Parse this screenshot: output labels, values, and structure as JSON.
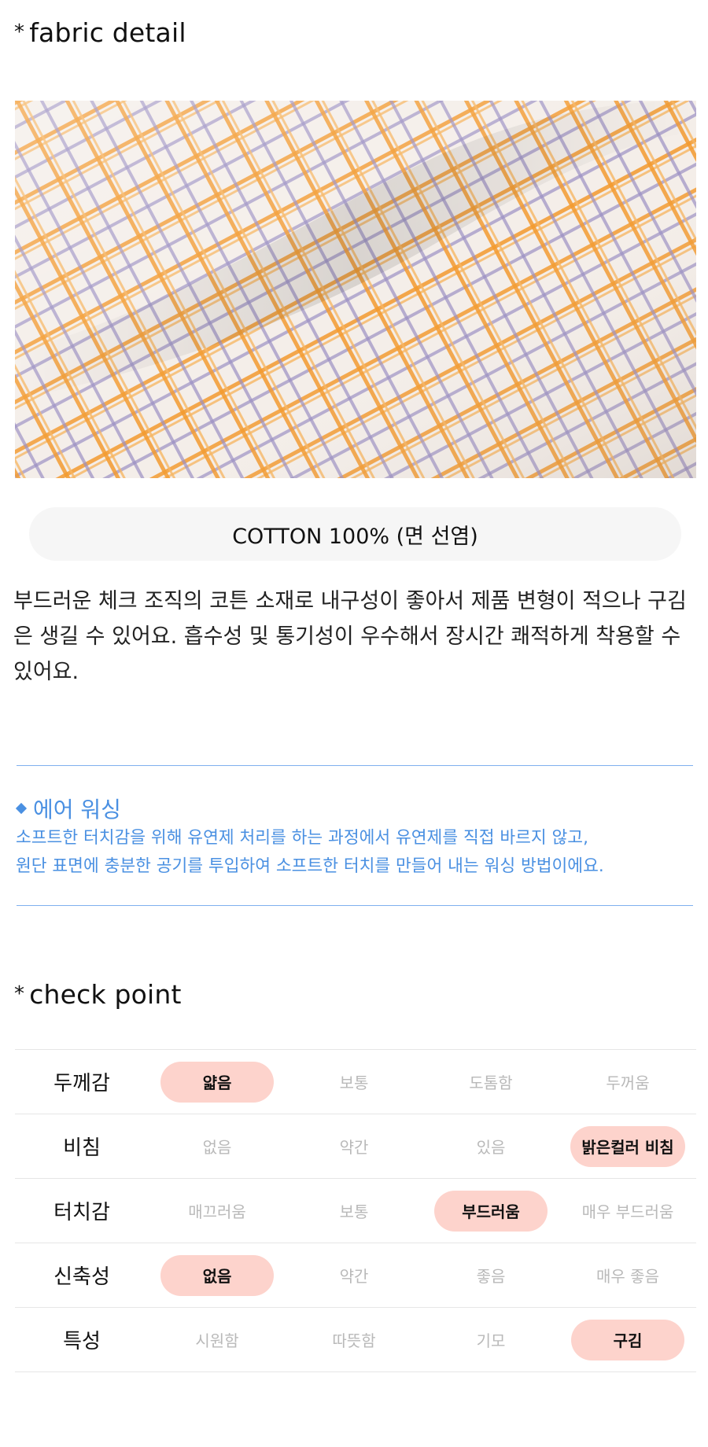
{
  "fabric_section": {
    "star": "*",
    "title": "fabric detail",
    "composition": "COTTON 100% (면 선염)",
    "description": "부드러운 체크 조직의 코튼 소재로 내구성이 좋아서 제품 변형이 적으나 구김은 생길 수 있어요. 흡수성 및 통기성이 우수해서 장시간 쾌적하게 착용할 수 있어요."
  },
  "wash_note": {
    "title": "에어 워싱",
    "line1": "소프트한 터치감을 위해 유연제 처리를 하는 과정에서 유연제를 직접 바르지 않고,",
    "line2": "원단 표면에 충분한 공기를 투입하여 소프트한 터치를 만들어 내는 워싱 방법이에요."
  },
  "check_section": {
    "star": "*",
    "title": "check point",
    "rows": [
      {
        "label": "두께감",
        "options": [
          "얇음",
          "보통",
          "도톰함",
          "두꺼움"
        ],
        "selected": 0
      },
      {
        "label": "비침",
        "options": [
          "없음",
          "약간",
          "있음",
          "밝은컬러 비침"
        ],
        "selected": 3
      },
      {
        "label": "터치감",
        "options": [
          "매끄러움",
          "보통",
          "부드러움",
          "매우 부드러움"
        ],
        "selected": 2
      },
      {
        "label": "신축성",
        "options": [
          "없음",
          "약간",
          "좋음",
          "매우 좋음"
        ],
        "selected": 0
      },
      {
        "label": "특성",
        "options": [
          "시원함",
          "따뜻함",
          "기모",
          "구김"
        ],
        "selected": 3
      }
    ]
  },
  "colors": {
    "accent_blue": "#4a90e2",
    "selected_pill": "#fdd3cc",
    "fabric_orange": "#f39a2e",
    "fabric_purple": "#9a8fc4"
  }
}
